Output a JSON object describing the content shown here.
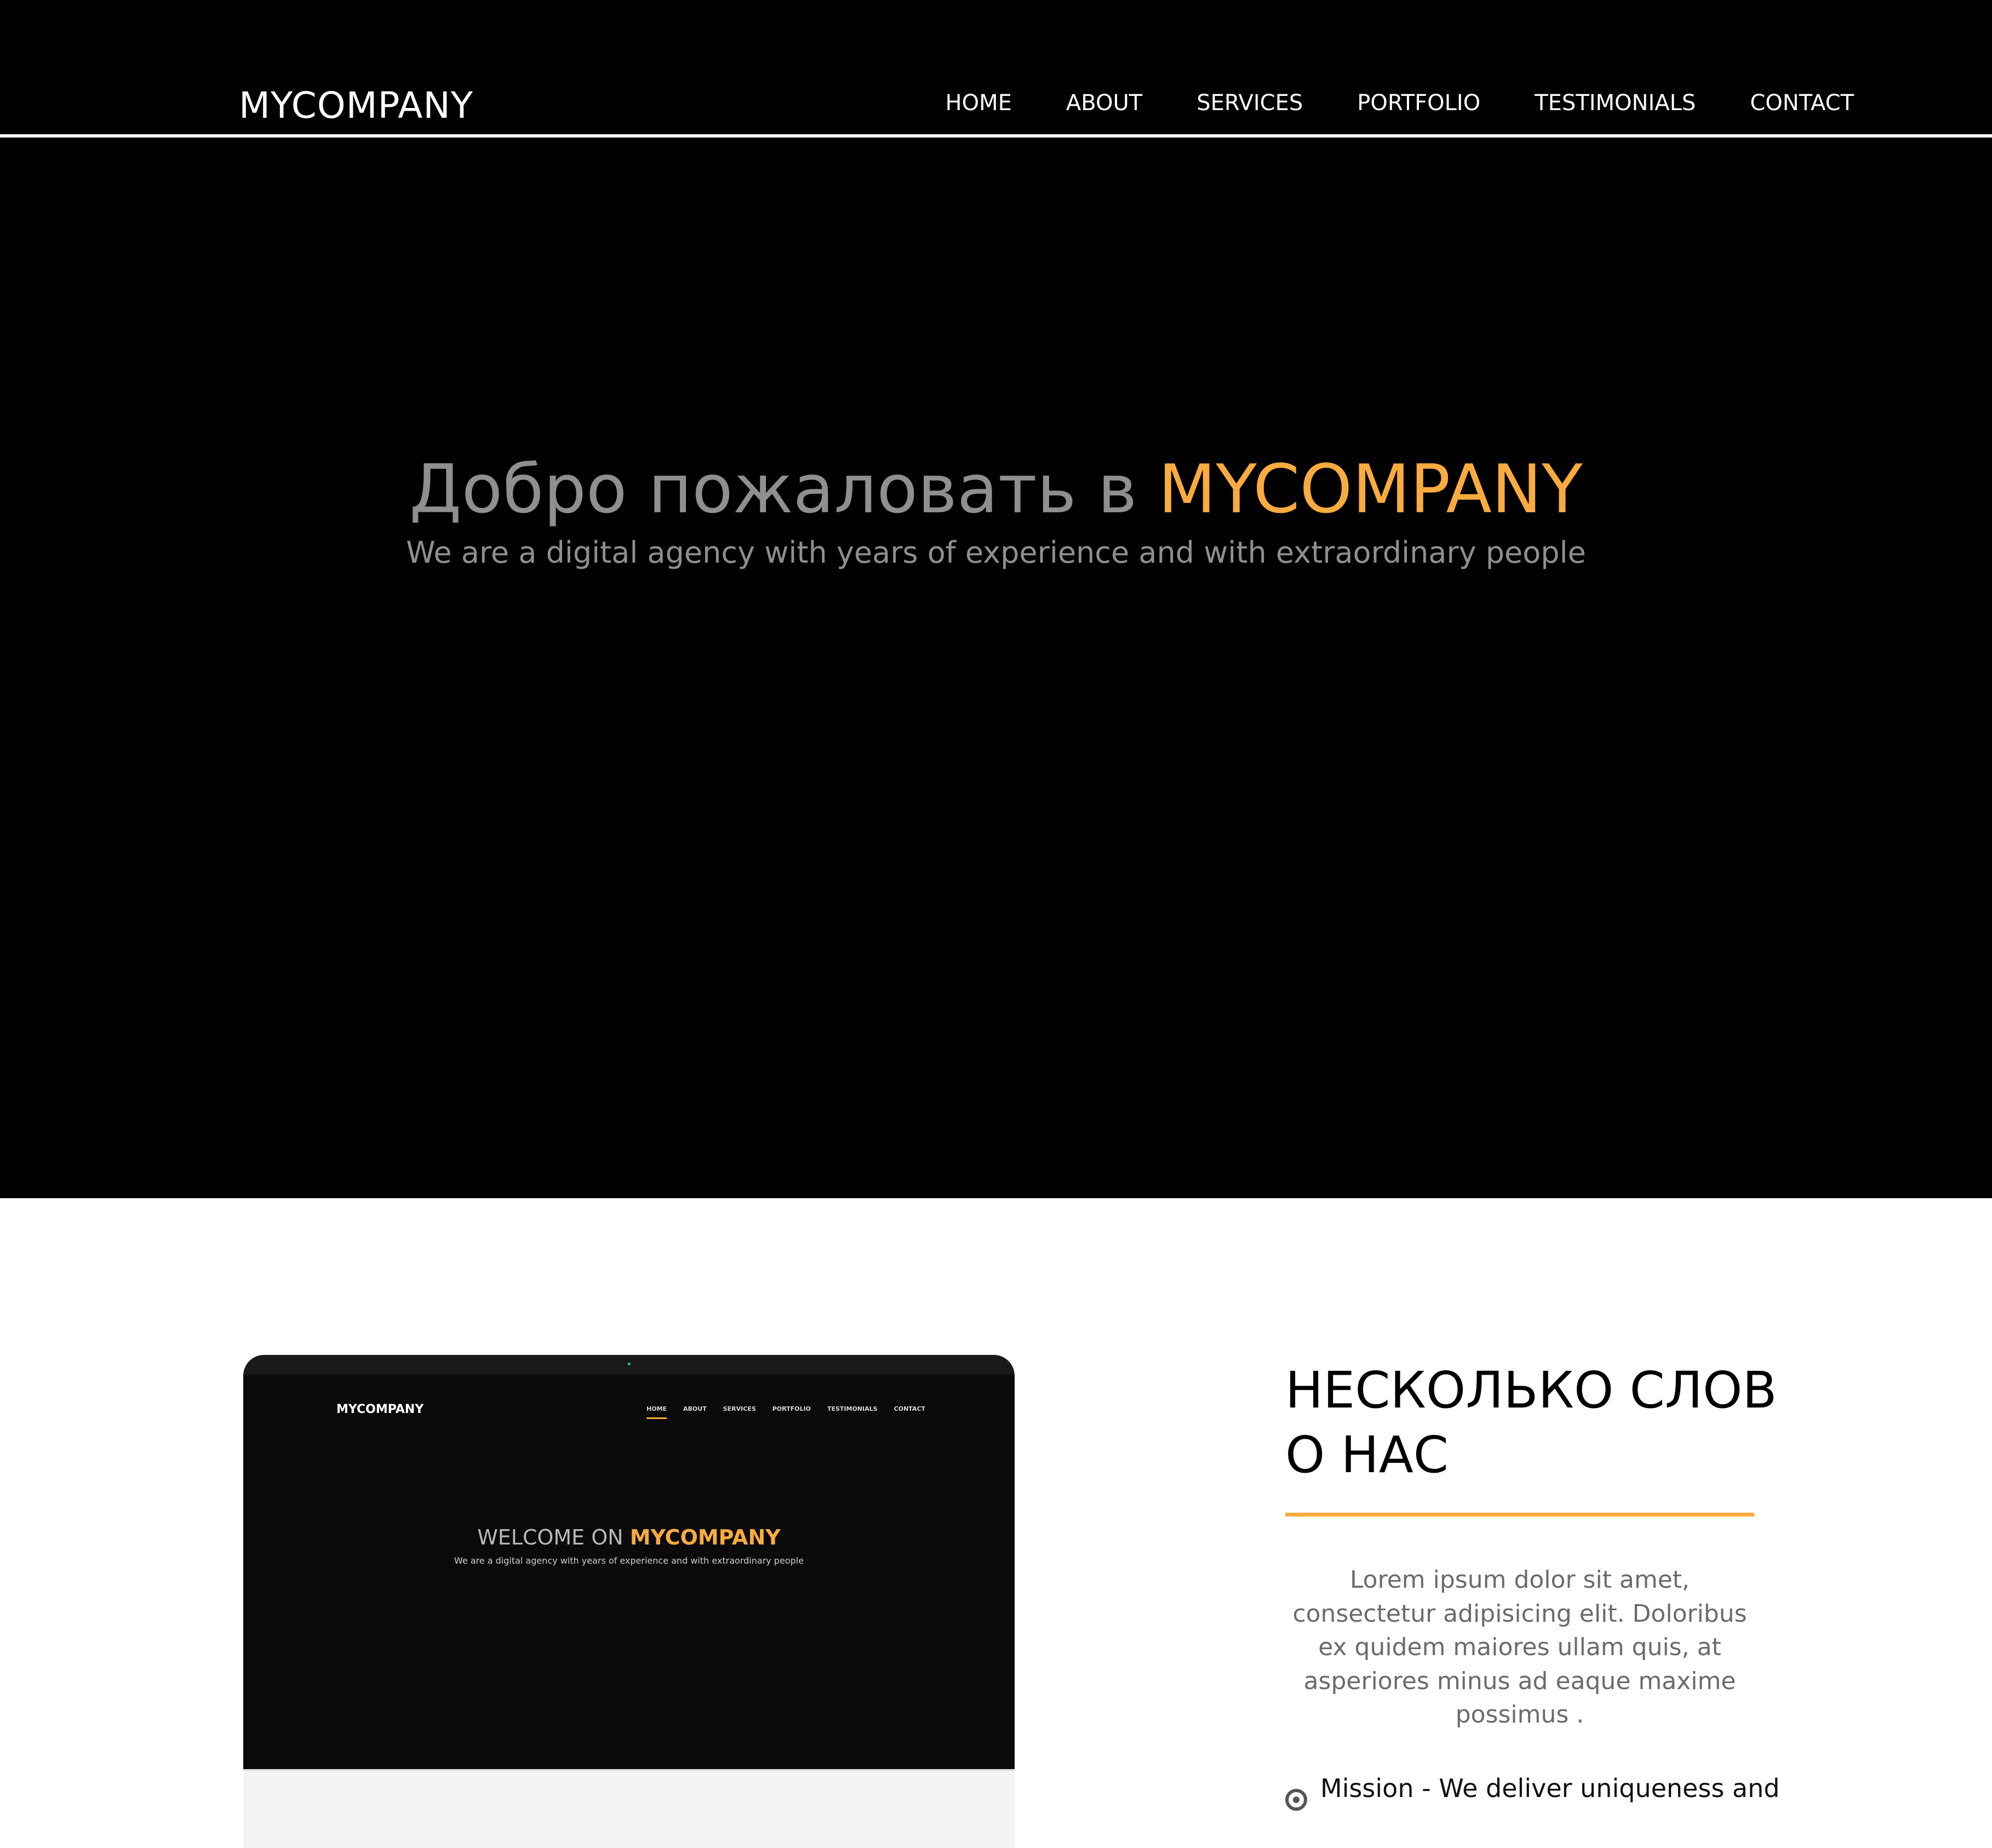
{
  "header": {
    "logo": "MYCOMPANY",
    "nav": [
      "HOME",
      "ABOUT",
      "SERVICES",
      "PORTFOLIO",
      "TESTIMONIALS",
      "CONTACT"
    ]
  },
  "hero": {
    "title_prefix": "Добро пожаловать в ",
    "title_accent": "MYCOMPANY",
    "subtitle": "We are a digital agency with years of experience and with extraordinary people"
  },
  "about": {
    "mockup": {
      "logo": "MYCOMPANY",
      "nav": [
        "HOME",
        "ABOUT",
        "SERVICES",
        "PORTFOLIO",
        "TESTIMONIALS",
        "CONTACT"
      ],
      "title_prefix": "WELCOME ON ",
      "title_accent": "MYCOMPANY",
      "subtitle": "We are a digital agency with years of experience and with extraordinary people"
    },
    "title_line1": "НЕСКОЛЬКО СЛОВ",
    "title_line2": "О НАС",
    "text": "Lorem ipsum dolor sit amet, consectetur adipisicing elit. Doloribus ex quidem maiores ullam quis, at asperiores minus ad eaque maxime possimus .",
    "mission": "Mission - We deliver uniqueness and"
  },
  "colors": {
    "accent": "#f9ab3f",
    "dark_bg": "#000000",
    "muted_text": "#8f8f8f"
  }
}
